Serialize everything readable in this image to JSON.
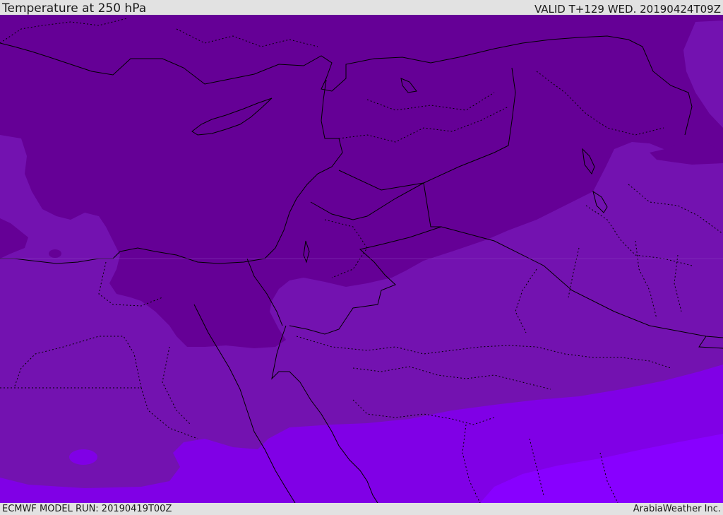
{
  "header": {
    "title": "Temperature at 250 hPa",
    "valid": "VALID T+129 WED. 20190424T09Z"
  },
  "footer": {
    "model_run": "ECMWF MODEL RUN: 20190419T00Z",
    "credit": "ArabiaWeather Inc."
  },
  "colors": {
    "band_coldest": "#650096",
    "band_cold": "#7312b0",
    "band_mid": "#8000e6",
    "band_warm": "#8800ff",
    "border": "#000000",
    "bar": "#e2e2e2"
  }
}
